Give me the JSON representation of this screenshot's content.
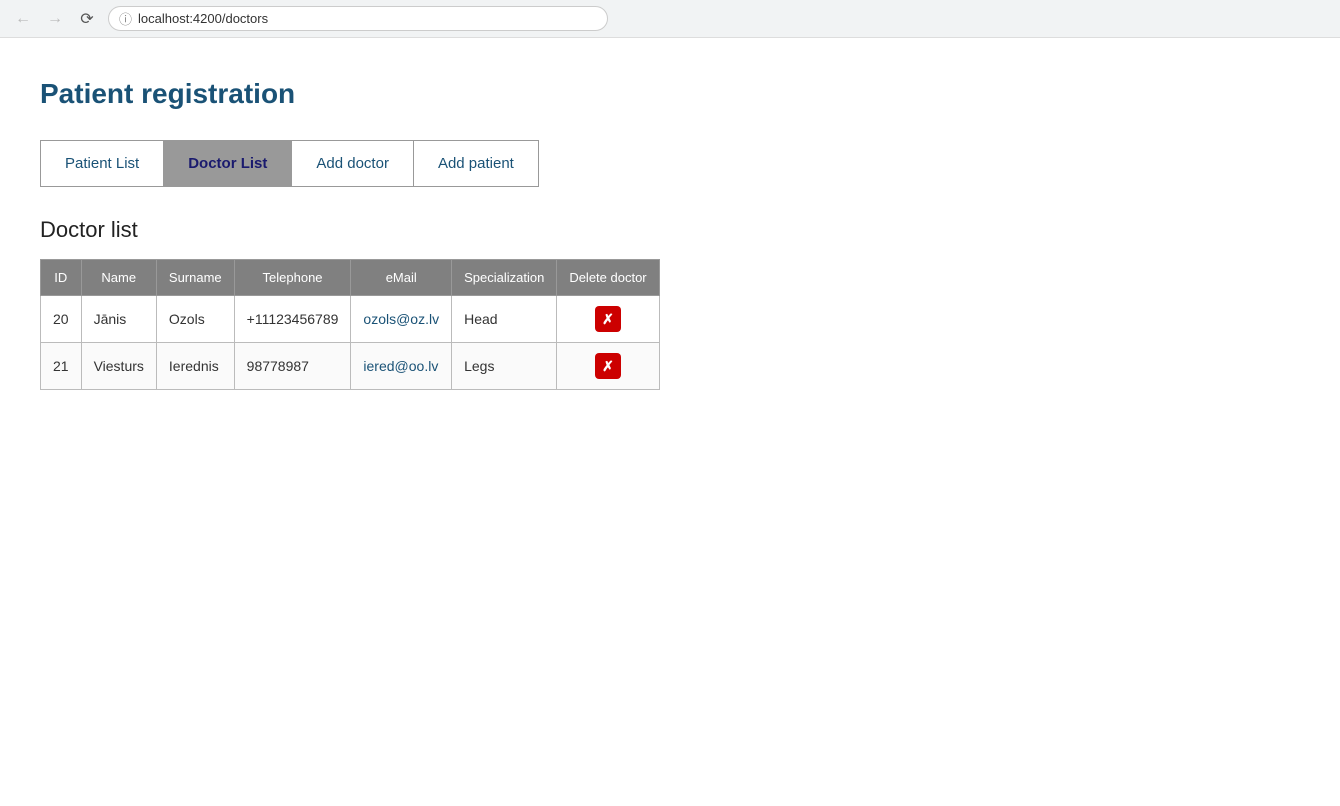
{
  "browser": {
    "url": "localhost:4200/doctors"
  },
  "app": {
    "title": "Patient registration"
  },
  "tabs": [
    {
      "id": "patient-list",
      "label": "Patient List",
      "active": false
    },
    {
      "id": "doctor-list",
      "label": "Doctor List",
      "active": true
    },
    {
      "id": "add-doctor",
      "label": "Add doctor",
      "active": false
    },
    {
      "id": "add-patient",
      "label": "Add patient",
      "active": false
    }
  ],
  "section": {
    "title": "Doctor list"
  },
  "table": {
    "columns": [
      "ID",
      "Name",
      "Surname",
      "Telephone",
      "eMail",
      "Specialization",
      "Delete doctor"
    ],
    "rows": [
      {
        "id": "20",
        "name": "Jānis",
        "surname": "Ozols",
        "telephone": "+11123456789",
        "email": "ozols@oz.lv",
        "specialization": "Head"
      },
      {
        "id": "21",
        "name": "Viesturs",
        "surname": "Ierednis",
        "telephone": "98778987",
        "email": "iered@oo.lv",
        "specialization": "Legs"
      }
    ]
  },
  "delete_label": "✕"
}
